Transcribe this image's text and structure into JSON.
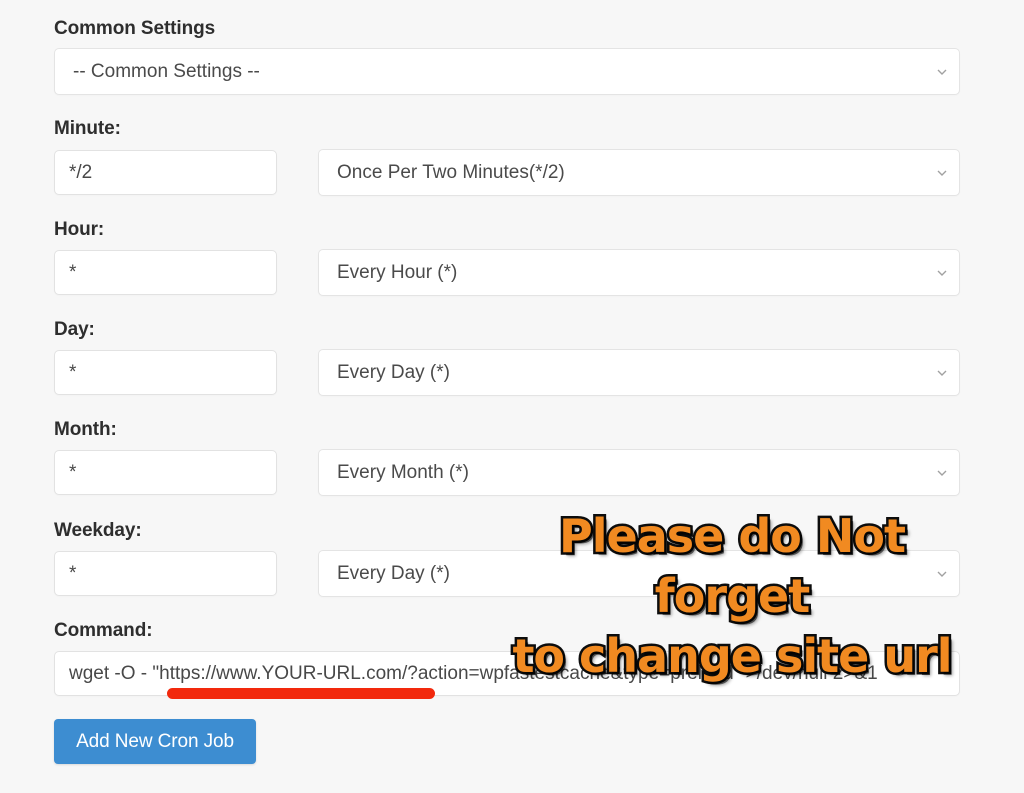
{
  "form": {
    "common_settings": {
      "label": "Common Settings",
      "selected": "-- Common Settings --"
    },
    "rows": [
      {
        "label": "Minute:",
        "value": "*/2",
        "selected": "Once Per Two Minutes(*/2)"
      },
      {
        "label": "Hour:",
        "value": "*",
        "selected": "Every Hour (*)"
      },
      {
        "label": "Day:",
        "value": "*",
        "selected": "Every Day (*)"
      },
      {
        "label": "Month:",
        "value": "*",
        "selected": "Every Month (*)"
      },
      {
        "label": "Weekday:",
        "value": "*",
        "selected": "Every Day (*)"
      }
    ],
    "command": {
      "label": "Command:",
      "value": "wget -O - \"https://www.YOUR-URL.com/?action=wpfastestcache&type=preload\" >/dev/null 2>&1"
    },
    "submit_label": "Add New Cron Job"
  },
  "annotations": {
    "note_text": "Please do Not forget\nto change site url",
    "note_color": "#f18a21",
    "note_outline_color": "#0d0d0d",
    "underline_color": "#f2290d"
  },
  "icons": {
    "chevron_down": "chevron-down-icon"
  },
  "colors": {
    "page_background": "#f7f7f7",
    "input_background": "#ffffff",
    "input_border": "#e2e2e2",
    "label_text": "#2e2e2e",
    "field_text": "#484848",
    "primary_button": "#3d8dd1"
  }
}
